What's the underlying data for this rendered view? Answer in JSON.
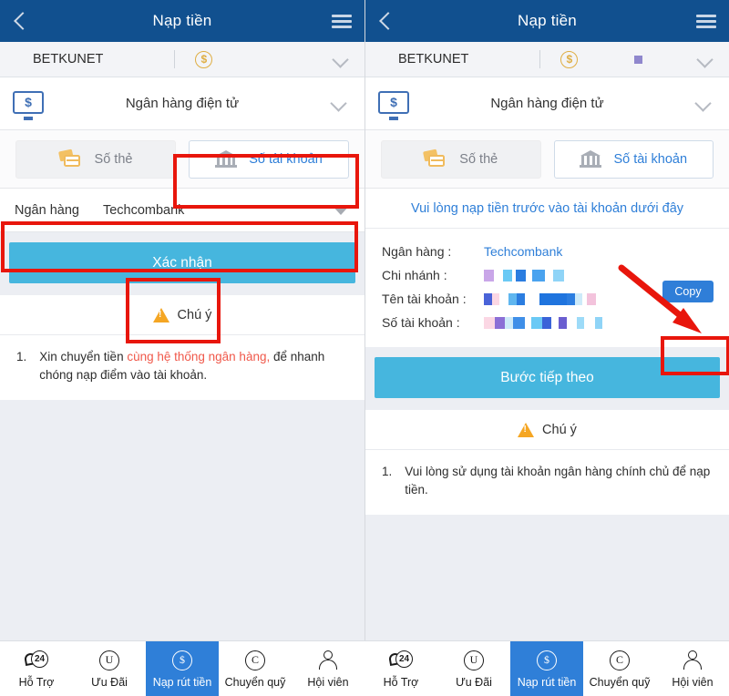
{
  "app": {
    "header_title": "Nạp tiền",
    "back_icon": "chevron-left-icon",
    "menu_icon": "hamburger-menu-icon"
  },
  "account_bar": {
    "username": "BETKUNET",
    "coin_icon": "dollar-coin-icon",
    "balance_masked": "",
    "expand_icon": "chevron-down-icon"
  },
  "method_row": {
    "icon": "monitor-dollar-icon",
    "label": "Ngân hàng điện tử",
    "expand_icon": "chevron-down-icon"
  },
  "tabs": {
    "card_number": {
      "label": "Số thẻ",
      "icon": "credit-cards-icon"
    },
    "account_number": {
      "label": "Số tài khoản",
      "icon": "bank-building-icon"
    }
  },
  "left_panel": {
    "bank_row": {
      "label": "Ngân hàng",
      "value": "Techcombank",
      "caret_icon": "caret-down-icon"
    },
    "confirm_button": "Xác nhận",
    "notice": {
      "title": "Chú ý",
      "warn_icon": "warning-triangle-icon",
      "item_number": "1.",
      "text_before": "Xin chuyển tiền ",
      "text_highlight": "cùng hệ thống ngân hàng,",
      "text_after": " để nhanh chóng nạp điểm vào tài khoản."
    }
  },
  "right_panel": {
    "info_title": "Vui lòng nạp tiền trước vào tài khoản dưới đây",
    "rows": [
      {
        "key": "Ngân hàng :",
        "value": "Techcombank",
        "masked": false
      },
      {
        "key": "Chi nhánh :",
        "value": "",
        "masked": true
      },
      {
        "key": "Tên tài khoản :",
        "value": "",
        "masked": true
      },
      {
        "key": "Số tài khoản :",
        "value": "",
        "masked": true
      }
    ],
    "copy_button": "Copy",
    "next_button": "Bước tiếp theo",
    "notice": {
      "title": "Chú ý",
      "warn_icon": "warning-triangle-icon",
      "item_number": "1.",
      "text": "Vui lòng sử dụng tài khoản ngân hàng chính chủ để nạp tiền."
    }
  },
  "bottom_nav": {
    "items": [
      {
        "label": "Hỗ Trợ",
        "icon": "support-24-icon",
        "glyph": "24",
        "active": false
      },
      {
        "label": "Ưu Đãi",
        "icon": "promotion-u-icon",
        "glyph": "U",
        "active": false
      },
      {
        "label": "Nạp rút tiền",
        "icon": "deposit-dollar-icon",
        "glyph": "$",
        "active": true
      },
      {
        "label": "Chuyển quỹ",
        "icon": "transfer-c-icon",
        "glyph": "C",
        "active": false
      },
      {
        "label": "Hội viên",
        "icon": "member-person-icon",
        "glyph": "",
        "active": false
      }
    ]
  },
  "annotations": {
    "color": "#e8160c",
    "boxes": [
      "tab-account-number",
      "bank-select-row",
      "confirm-button",
      "copy-button"
    ],
    "arrow": "red-arrow-pointing-to-copy"
  },
  "colors": {
    "header_blue": "#11508f",
    "accent_blue": "#2f7fd8",
    "button_cyan": "#46b6de",
    "annotation_red": "#e8160c",
    "warning_orange": "#f5a623",
    "highlight_red": "#f0584a",
    "coin_gold": "#dfae43"
  }
}
